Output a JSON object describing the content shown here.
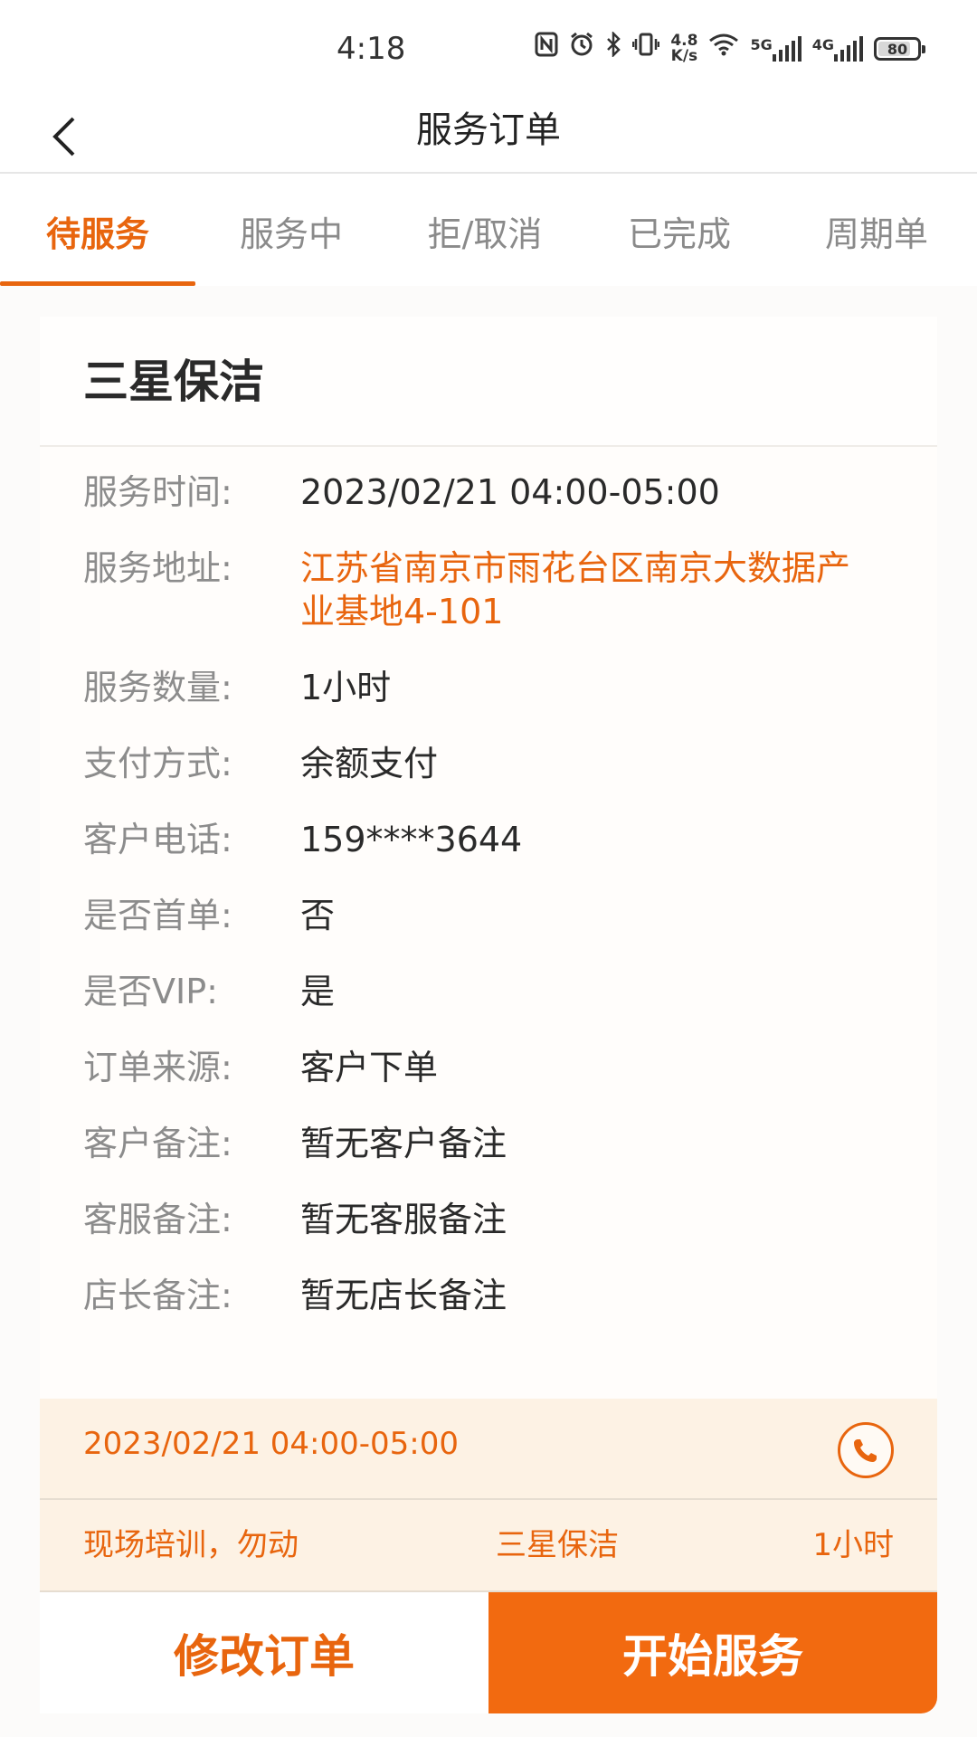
{
  "status_bar": {
    "time": "4:18",
    "net_speed_value": "4.8",
    "net_speed_unit": "K/s",
    "sim1_type": "5G",
    "sim2_type": "4G",
    "battery": "80",
    "battery_level_percent": 80,
    "icons": [
      "nfc-icon",
      "alarm-icon",
      "bluetooth-icon",
      "vibrate-icon",
      "wifi-icon",
      "signal-icon",
      "battery-icon"
    ]
  },
  "navbar": {
    "title": "服务订单",
    "back_icon": "chevron-left-icon"
  },
  "tabs": [
    {
      "label": "待服务",
      "active": true
    },
    {
      "label": "服务中",
      "active": false
    },
    {
      "label": "拒/取消",
      "active": false
    },
    {
      "label": "已完成",
      "active": false
    },
    {
      "label": "周期单",
      "active": false
    }
  ],
  "order": {
    "title": "三星保洁",
    "fields": [
      {
        "label": "服务时间:",
        "value": "2023/02/21 04:00-05:00"
      },
      {
        "label": "服务地址:",
        "value": "江苏省南京市雨花台区南京大数据产业基地4-101"
      },
      {
        "label": "服务数量:",
        "value": "1小时"
      },
      {
        "label": "支付方式:",
        "value": "余额支付"
      },
      {
        "label": "客户电话:",
        "value": "159****3644"
      },
      {
        "label": "是否首单:",
        "value": "否"
      },
      {
        "label": "是否VIP:",
        "value": "是"
      },
      {
        "label": "订单来源:",
        "value": "客户下单"
      },
      {
        "label": "客户备注:",
        "value": "暂无客户备注"
      },
      {
        "label": "客服备注:",
        "value": "暂无客服备注"
      },
      {
        "label": "店长备注:",
        "value": "暂无店长备注"
      }
    ],
    "summary": {
      "time": "2023/02/21 04:00-05:00",
      "phone_icon": "phone-icon",
      "note": "现场培训，勿动",
      "service": "三星保洁",
      "quantity": "1小时"
    },
    "actions": {
      "modify": "修改订单",
      "start": "开始服务"
    }
  },
  "colors": {
    "accent": "#e8650e",
    "primary_button": "#f26a10",
    "summary_bg": "#fdf2e4"
  }
}
